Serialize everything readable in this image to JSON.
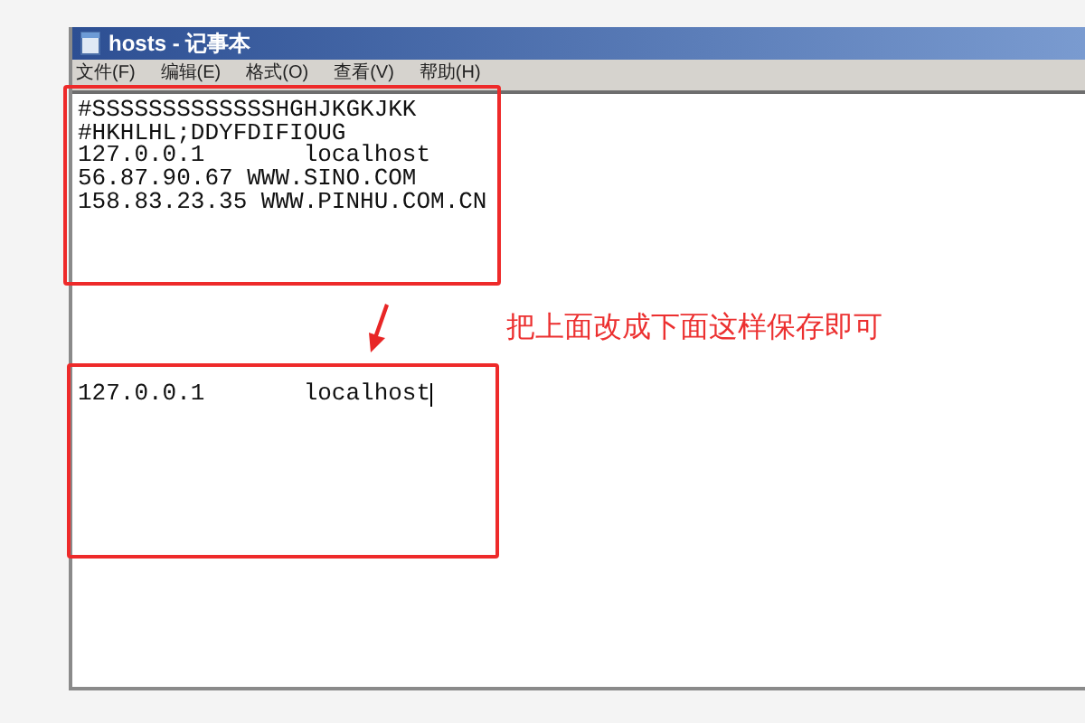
{
  "window": {
    "title": "hosts - 记事本"
  },
  "menu": [
    {
      "label": "文件(F)"
    },
    {
      "label": "编辑(E)"
    },
    {
      "label": "格式(O)"
    },
    {
      "label": "查看(V)"
    },
    {
      "label": "帮助(H)"
    }
  ],
  "editor": {
    "before_lines": [
      "#SSSSSSSSSSSSSHGHJKGKJKK",
      "#HKHLHL;DDYFDIFIOUG",
      "127.0.0.1       localhost",
      "56.87.90.67 WWW.SINO.COM",
      "158.83.23.35 WWW.PINHU.COM.CN"
    ],
    "after_lines": [
      "127.0.0.1       localhost"
    ]
  },
  "annotation": {
    "text": "把上面改成下面这样保存即可"
  }
}
